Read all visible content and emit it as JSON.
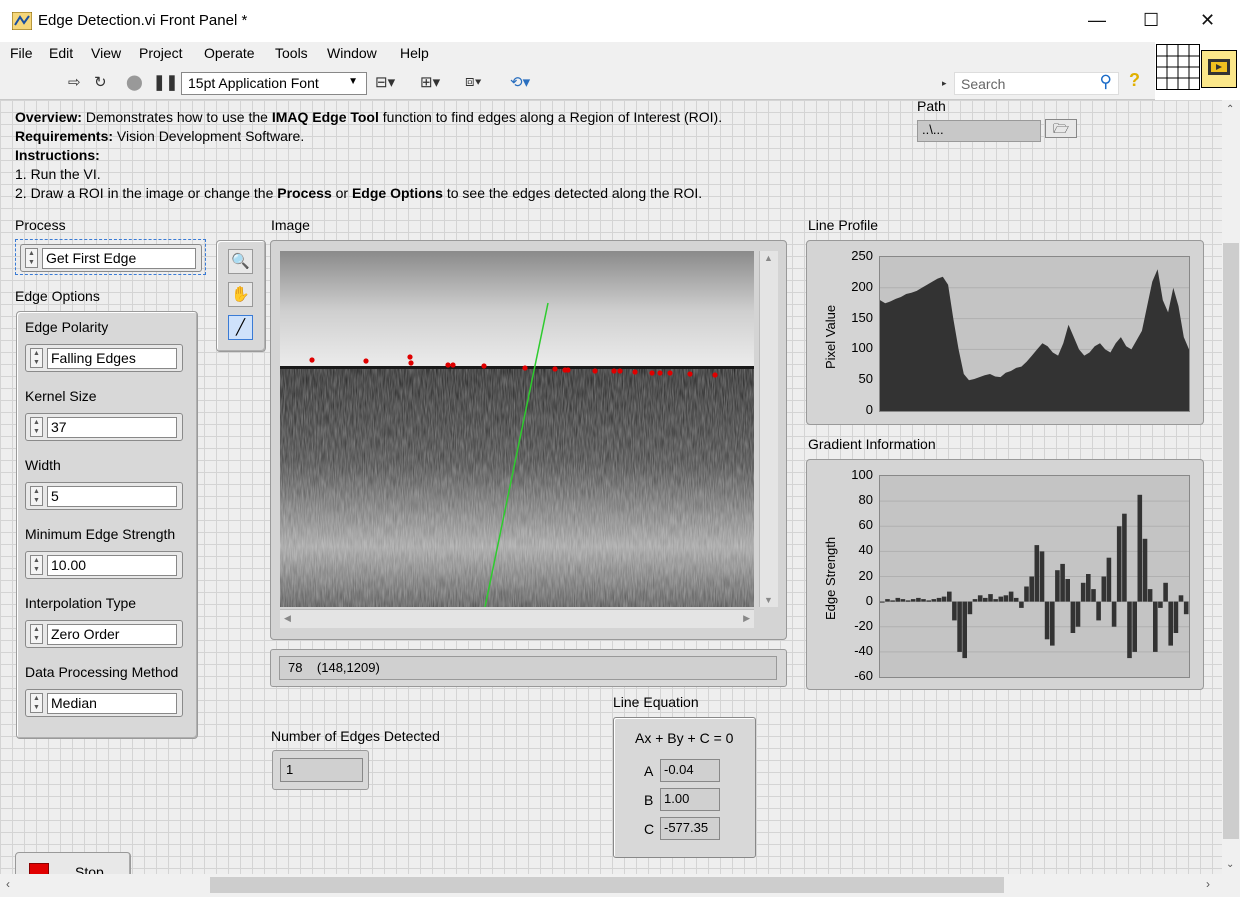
{
  "window": {
    "title": "Edge Detection.vi Front Panel *",
    "minimize": "—",
    "maximize": "☐",
    "close": "✕"
  },
  "menu": [
    "File",
    "Edit",
    "View",
    "Project",
    "Operate",
    "Tools",
    "Window",
    "Help"
  ],
  "toolbar": {
    "font": "15pt Application Font",
    "search_placeholder": "Search",
    "help": "?"
  },
  "description": {
    "overview_label": "Overview:",
    "overview_text": " Demonstrates how to use the ",
    "overview_bold": "IMAQ Edge Tool",
    "overview_tail": " function to find edges along a Region of Interest (ROI).",
    "req_label": "Requirements:",
    "req_text": " Vision Development Software.",
    "instr_label": "Instructions:",
    "step1": "1. Run the VI.",
    "step2_a": "2. Draw a ROI in the image or change the ",
    "step2_b": "Process",
    "step2_c": " or ",
    "step2_d": "Edge Options",
    "step2_e": " to see the edges detected along the ROI."
  },
  "path": {
    "label": "Path",
    "value": "..\\..."
  },
  "process": {
    "label": "Process",
    "value": "Get First Edge"
  },
  "edge_options": {
    "label": "Edge Options",
    "polarity": {
      "label": "Edge Polarity",
      "value": "Falling Edges"
    },
    "kernel": {
      "label": "Kernel Size",
      "value": "37"
    },
    "width": {
      "label": "Width",
      "value": "5"
    },
    "min_strength": {
      "label": "Minimum Edge Strength",
      "value": "10.00"
    },
    "interp": {
      "label": "Interpolation Type",
      "value": "Zero Order"
    },
    "method": {
      "label": "Data Processing Method",
      "value": "Median"
    }
  },
  "stop": {
    "label": "Stop"
  },
  "image": {
    "label": "Image",
    "status": "78    (148,1209)"
  },
  "num_edges": {
    "label": "Number of Edges Detected",
    "value": "1"
  },
  "line_eq": {
    "label": "Line Equation",
    "formula": "Ax + By + C = 0",
    "a_label": "A",
    "a": "-0.04",
    "b_label": "B",
    "b": "1.00",
    "c_label": "C",
    "c": "-577.35"
  },
  "colors": {
    "panel": "#eeeeee",
    "plot": "#c4c4c4",
    "trace": "#333333",
    "edge_marker": "#e00000",
    "roi": "#2ecc2e"
  },
  "chart_data": [
    {
      "type": "area",
      "title": "Line Profile",
      "ylabel": "Pixel Value",
      "ylim": [
        0,
        250
      ],
      "yticks": [
        "250",
        "200",
        "150",
        "100",
        "50",
        "0"
      ],
      "grid": true,
      "values": [
        180,
        175,
        178,
        182,
        185,
        190,
        192,
        195,
        200,
        205,
        210,
        215,
        218,
        205,
        150,
        100,
        60,
        50,
        52,
        55,
        58,
        60,
        56,
        55,
        62,
        65,
        70,
        72,
        80,
        90,
        100,
        110,
        105,
        95,
        90,
        110,
        140,
        120,
        100,
        90,
        95,
        105,
        110,
        100,
        95,
        110,
        120,
        105,
        100,
        115,
        130,
        170,
        210,
        230,
        180,
        160,
        200,
        170,
        120,
        100
      ]
    },
    {
      "type": "bar",
      "title": "Gradient Information",
      "ylabel": "Edge Strength",
      "ylim": [
        -60,
        100
      ],
      "yticks": [
        "100",
        "80",
        "60",
        "40",
        "20",
        "0",
        "-20",
        "-40",
        "-60"
      ],
      "grid": true,
      "values": [
        0,
        2,
        1,
        3,
        2,
        1,
        2,
        3,
        2,
        1,
        2,
        3,
        4,
        8,
        -15,
        -40,
        -45,
        -10,
        2,
        5,
        3,
        6,
        2,
        4,
        5,
        8,
        3,
        -5,
        12,
        20,
        45,
        40,
        -30,
        -35,
        25,
        30,
        18,
        -25,
        -20,
        15,
        22,
        10,
        -15,
        20,
        35,
        -20,
        60,
        70,
        -45,
        -40,
        85,
        50,
        10,
        -40,
        -5,
        15,
        -35,
        -25,
        5,
        -10
      ]
    }
  ]
}
